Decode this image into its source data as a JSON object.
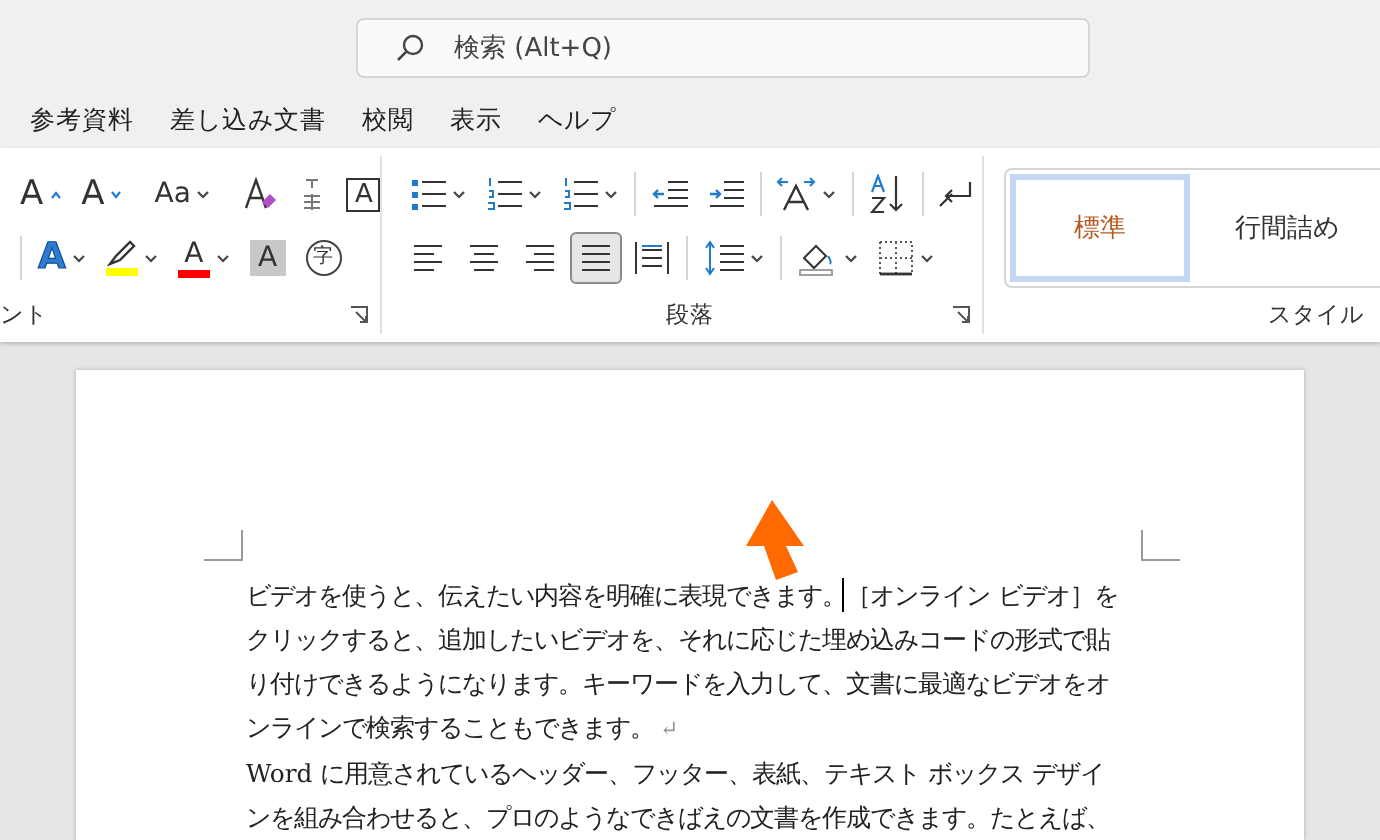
{
  "search": {
    "placeholder": "検索 (Alt+Q)"
  },
  "tabs": [
    {
      "label": "参考資料",
      "selected": false
    },
    {
      "label": "差し込み文書",
      "selected": false
    },
    {
      "label": "校閲",
      "selected": false
    },
    {
      "label": "表示",
      "selected": false
    },
    {
      "label": "ヘルプ",
      "selected": false
    }
  ],
  "font_group": {
    "label": "ント",
    "row1": [
      [
        {
          "kind": "grow",
          "text": "A"
        },
        {
          "kind": "shrink",
          "text": "A"
        }
      ],
      [
        {
          "kind": "case",
          "text": "Aa",
          "dropdown": true
        }
      ],
      [
        {
          "kind": "clear"
        },
        {
          "kind": "ruby"
        },
        {
          "kind": "boxed",
          "text": "A"
        }
      ]
    ],
    "row2": [
      [
        {
          "kind": "effects",
          "text": "A",
          "dropdown": true
        },
        {
          "kind": "highlight",
          "color": "#ffff00",
          "dropdown": true
        },
        {
          "kind": "font_color",
          "text": "A",
          "color": "#ff0000",
          "dropdown": true
        },
        {
          "kind": "shading",
          "text": "A"
        },
        {
          "kind": "enclose",
          "text": "字"
        }
      ]
    ]
  },
  "paragraph_group": {
    "label": "段落",
    "row1": [
      [
        {
          "kind": "bullets",
          "dropdown": true
        },
        {
          "kind": "numbering",
          "dropdown": true
        },
        {
          "kind": "multilevel",
          "dropdown": true
        }
      ],
      [
        {
          "kind": "outdent"
        },
        {
          "kind": "indent"
        }
      ],
      [
        {
          "kind": "asian",
          "dropdown": true
        }
      ],
      [
        {
          "kind": "sort"
        }
      ],
      [
        {
          "kind": "marks"
        }
      ]
    ],
    "alignment": [
      {
        "kind": "left",
        "selected": false
      },
      {
        "kind": "center",
        "selected": false
      },
      {
        "kind": "right",
        "selected": false
      },
      {
        "kind": "justify",
        "selected": true
      },
      {
        "kind": "distribute",
        "selected": false
      }
    ],
    "row2": [
      [
        {
          "kind": "spacing",
          "dropdown": true
        }
      ],
      [
        {
          "kind": "fill",
          "dropdown": true
        },
        {
          "kind": "borders",
          "dropdown": true
        }
      ]
    ]
  },
  "styles_group": {
    "label": "スタイル",
    "styles": [
      {
        "name": "標準",
        "selected": true
      },
      {
        "name": "行間詰め",
        "selected": false
      }
    ]
  },
  "document": {
    "paragraphs": [
      {
        "lines": [
          "ビデオを使うと、伝えたい内容を明確に表現できます。［オンライン ビデオ］を",
          "クリックすると、追加したいビデオを、それに応じた埋め込みコードの形式で貼",
          "り付けできるようになります。キーワードを入力して、文書に最適なビデオをオ",
          "ンラインで検索することもできます。"
        ],
        "mark": "↵"
      },
      {
        "lines": [
          "Word に用意されているヘッダー、フッター、表紙、テキスト ボックス デザイ",
          "ンを組み合わせると、プロのようなできばえの文書を作成できます。たとえば、"
        ]
      }
    ]
  }
}
